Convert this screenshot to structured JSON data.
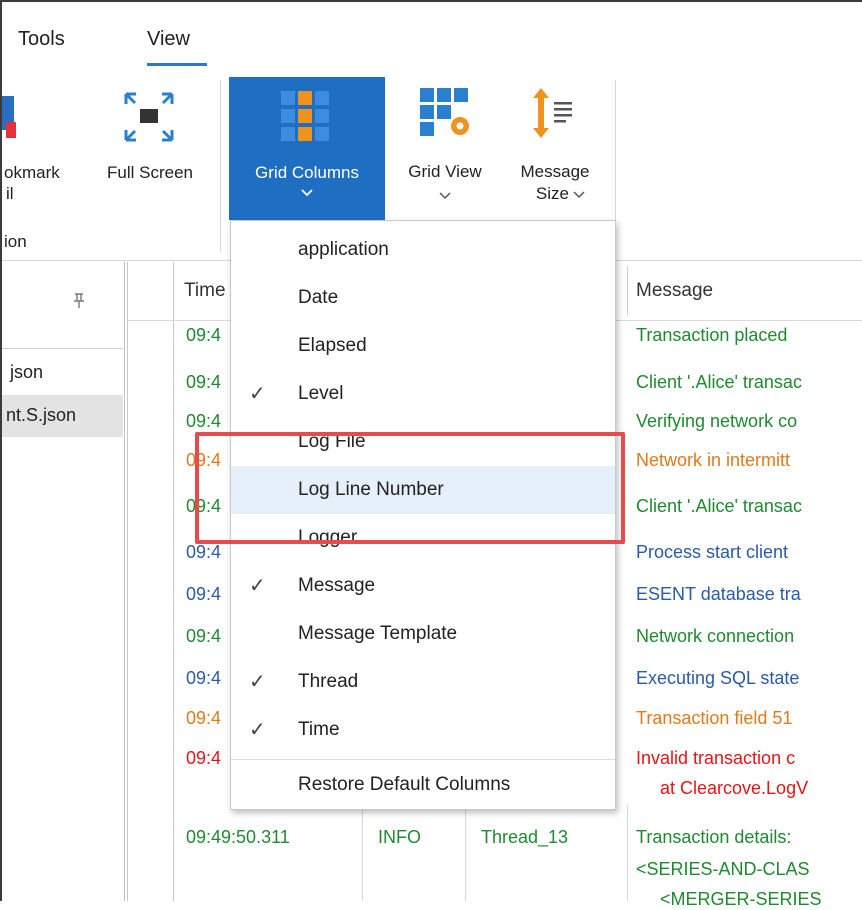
{
  "ribbon": {
    "tabs": [
      "Tools",
      "View"
    ],
    "buttons": {
      "bookmark_line1": "okmark",
      "bookmark_line2": "il",
      "fullscreen": "Full Screen",
      "grid_columns": "Grid Columns",
      "grid_view": "Grid View",
      "message_size_line1": "Message",
      "message_size_line2": "Size"
    },
    "group_label": "ion"
  },
  "left_panel": {
    "pin": "📌",
    "files": [
      {
        "name": "json",
        "selected": false
      },
      {
        "name": "nt.S.json",
        "selected": true
      }
    ]
  },
  "grid": {
    "headers": {
      "time": "Time",
      "message": "Message"
    },
    "rows": [
      {
        "time": "09:4",
        "message": "Transaction placed",
        "color": "green"
      },
      {
        "time": "09:4",
        "message": "Client '.Alice' transac",
        "color": "green"
      },
      {
        "time": "09:4",
        "message": "Verifying network co",
        "color": "green"
      },
      {
        "time": "09:4",
        "message": "Network in intermitt",
        "color": "orange"
      },
      {
        "time": "09:4",
        "message": "Client '.Alice' transac",
        "color": "green"
      },
      {
        "time": "09:4",
        "message": "Process start client",
        "color": "blue"
      },
      {
        "time": "09:4",
        "message": "ESENT database tra",
        "color": "blue"
      },
      {
        "time": "09:4",
        "message": "Network connection",
        "color": "green"
      },
      {
        "time": "09:4",
        "message": "Executing SQL state",
        "color": "blue"
      },
      {
        "time": "09:4",
        "message": "Transaction field 51",
        "color": "orange"
      },
      {
        "time": "09:4",
        "message": "Invalid transaction c",
        "message2": "at Clearcove.LogV",
        "color": "red"
      }
    ],
    "last_row": {
      "time": "09:49:50.311",
      "level": "INFO",
      "thread": "Thread_13",
      "message": "Transaction details:",
      "message2": "<SERIES-AND-CLAS",
      "message3": "<MERGER-SERIES"
    }
  },
  "menu": {
    "items": [
      {
        "label": "application",
        "checked": false
      },
      {
        "label": "Date",
        "checked": false
      },
      {
        "label": "Elapsed",
        "checked": false
      },
      {
        "label": "Level",
        "checked": true
      },
      {
        "label": "Log File",
        "checked": false
      },
      {
        "label": "Log Line Number",
        "checked": false,
        "highlighted": true
      },
      {
        "label": "Logger",
        "checked": false
      },
      {
        "label": "Message",
        "checked": true
      },
      {
        "label": "Message Template",
        "checked": false
      },
      {
        "label": "Thread",
        "checked": true
      },
      {
        "label": "Time",
        "checked": true
      }
    ],
    "restore": "Restore Default Columns",
    "check_glyph": "✓"
  }
}
